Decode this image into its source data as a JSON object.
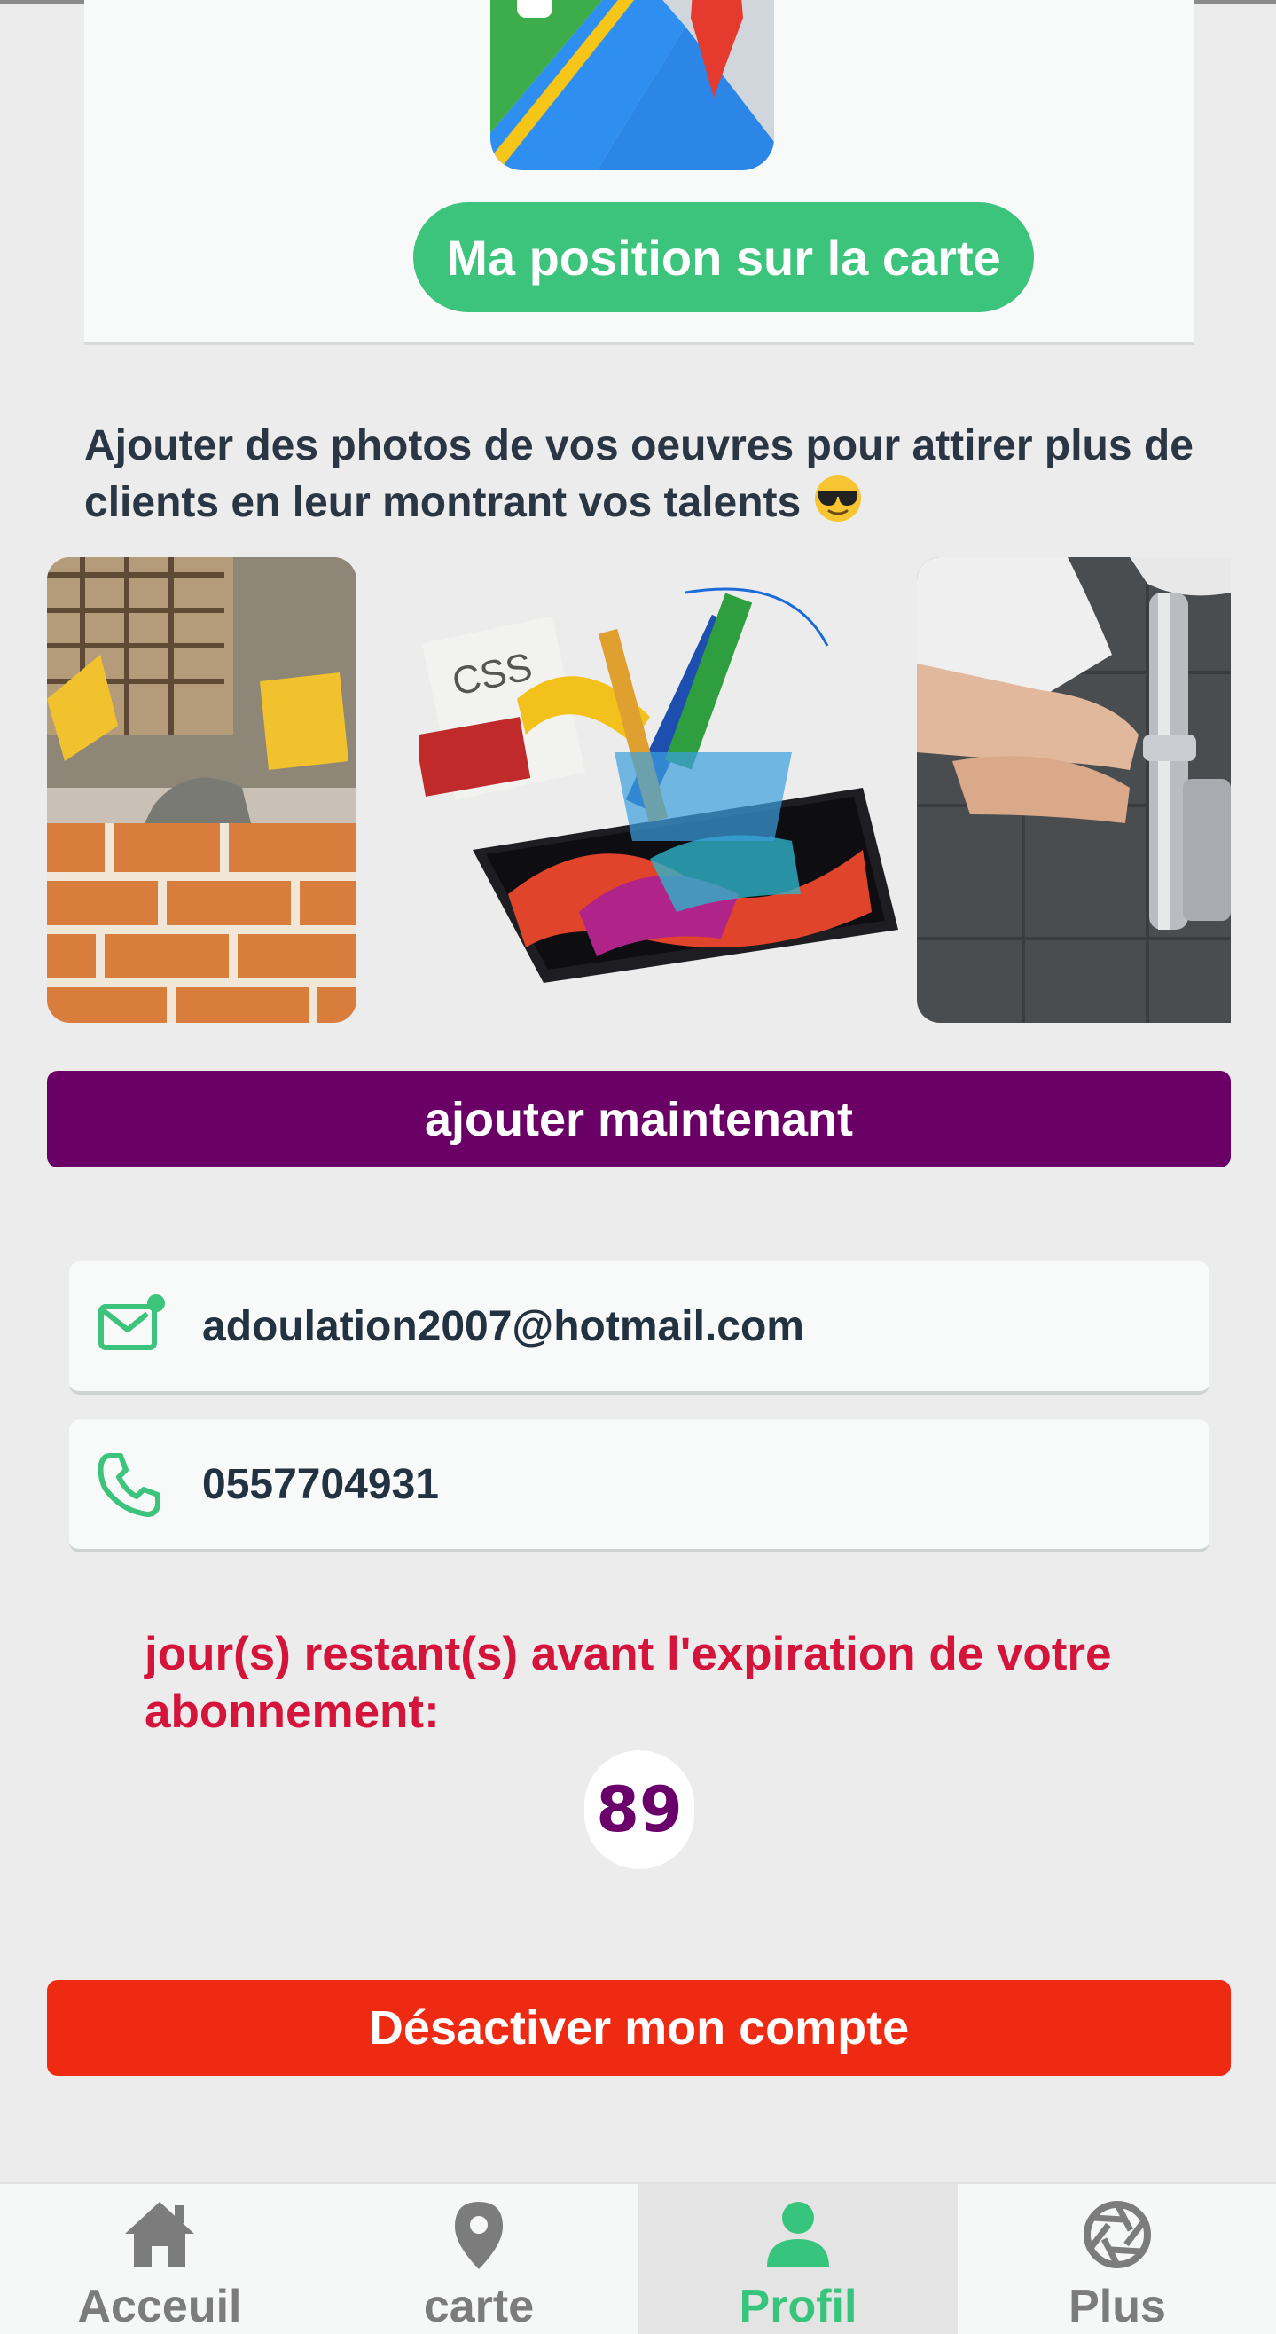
{
  "map_section": {
    "button_label": "Ma position sur la carte",
    "icon": "google-maps-icon"
  },
  "promo": {
    "text": "Ajouter des photos de vos oeuvres  pour attirer plus de clients en leur montrant vos talents",
    "emoji": "sunglasses-emoji"
  },
  "gallery": {
    "images": [
      "bricklayer-photo",
      "graphic-design-tools-illustration",
      "plumber-photo"
    ],
    "css_label": "CSS"
  },
  "add_button": {
    "label": "ajouter maintenant"
  },
  "contact": {
    "email": "adoulation2007@hotmail.com",
    "email_icon": "mail-icon",
    "phone": "0557704931",
    "phone_icon": "phone-icon"
  },
  "subscription": {
    "label": "jour(s) restant(s) avant l'expiration de votre abonnement:",
    "days_remaining": "89"
  },
  "deactivate_button": {
    "label": "Désactiver mon compte"
  },
  "bottom_nav": {
    "items": [
      {
        "label": "Acceuil",
        "icon": "home-icon"
      },
      {
        "label": "carte",
        "icon": "map-pin-icon"
      },
      {
        "label": "Profil",
        "icon": "person-icon",
        "active": true
      },
      {
        "label": "Plus",
        "icon": "aperture-icon"
      }
    ]
  },
  "colors": {
    "green": "#3cc37c",
    "purple": "#6a0066",
    "red": "#ee2a13",
    "crimson_text": "#d4143b"
  }
}
